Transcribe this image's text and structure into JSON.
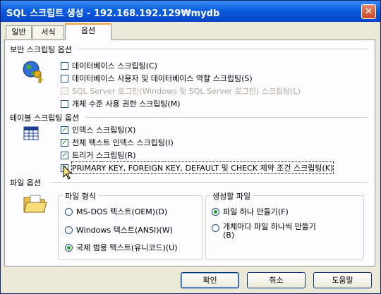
{
  "window": {
    "title": "SQL 스크립트 생성 - 192.168.192.129₩mydb",
    "close_symbol": "✕"
  },
  "tabs": [
    {
      "label": "일반",
      "active": false
    },
    {
      "label": "서식",
      "active": false
    },
    {
      "label": "옵션",
      "active": true
    }
  ],
  "security": {
    "title": "보안 스크립팅 옵션",
    "icon": "security-key-globe-icon",
    "options": [
      {
        "label": "데이터베이스 스크립팅(C)",
        "checked": false,
        "enabled": true
      },
      {
        "label": "데이터베이스 사용자 및 데이터베이스 역할 스크립팅(S)",
        "checked": false,
        "enabled": true
      },
      {
        "label": "SQL Server 로그인(Windows 및 SQL Server 로그인) 스크립팅(L)",
        "checked": false,
        "enabled": false
      },
      {
        "label": "개체 수준 사용 권한 스크립팅(M)",
        "checked": false,
        "enabled": true
      }
    ]
  },
  "table": {
    "title": "테이블 스크립팅 옵션",
    "icon": "table-grid-icon",
    "options": [
      {
        "label": "인덱스 스크립팅(X)",
        "checked": true
      },
      {
        "label": "전체 텍스트 인덱스 스크립팅(I)",
        "checked": true
      },
      {
        "label": "트리거 스크립팅(R)",
        "checked": true
      },
      {
        "label": "PRIMARY KEY, FOREIGN KEY, DEFAULT 및 CHECK 제약 조건 스크립팅(K)",
        "checked": true
      }
    ]
  },
  "file": {
    "title": "파일 옵션",
    "icon": "open-folder-icon",
    "format_group": {
      "title": "파일 형식",
      "options": [
        {
          "label": "MS-DOS 텍스트(OEM)(D)",
          "selected": false
        },
        {
          "label": "Windows 텍스트(ANSI)(W)",
          "selected": false
        },
        {
          "label": "국제 범용 텍스트(유니코드)(U)",
          "selected": true
        }
      ]
    },
    "output_group": {
      "title": "생성할 파일",
      "options": [
        {
          "label": "파일 하나 만들기(F)",
          "selected": true
        },
        {
          "label_line1": "개체마다 파일 하나씩 만들기",
          "label_line2": "(B)",
          "selected": false
        }
      ]
    }
  },
  "buttons": {
    "ok": "확인",
    "cancel": "취소",
    "help": "도움말"
  },
  "colors": {
    "title_bar": "#0a5ee0",
    "dialog_bg": "#ece9d8",
    "check_mark": "#21a121",
    "tab_highlight": "#f1a33b"
  }
}
